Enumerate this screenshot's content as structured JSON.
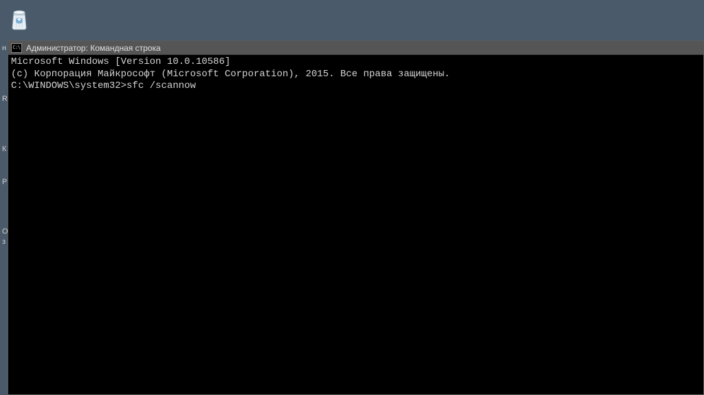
{
  "desktop": {
    "recycle_bin": "Корзина",
    "bg_text_r": "R",
    "bg_text_k": "К",
    "bg_text_p": "P",
    "bg_text_n": "н",
    "bg_text_o": "O",
    "bg_text_z": "з"
  },
  "cmd": {
    "titlebar_icon": "C:\\",
    "title": "Администратор: Командная строка",
    "line1": "Microsoft Windows [Version 10.0.10586]",
    "line2": "(c) Корпорация Майкрософт (Microsoft Corporation), 2015. Все права защищены.",
    "line3": "",
    "prompt": "C:\\WINDOWS\\system32>",
    "command": "sfc /scannow"
  }
}
